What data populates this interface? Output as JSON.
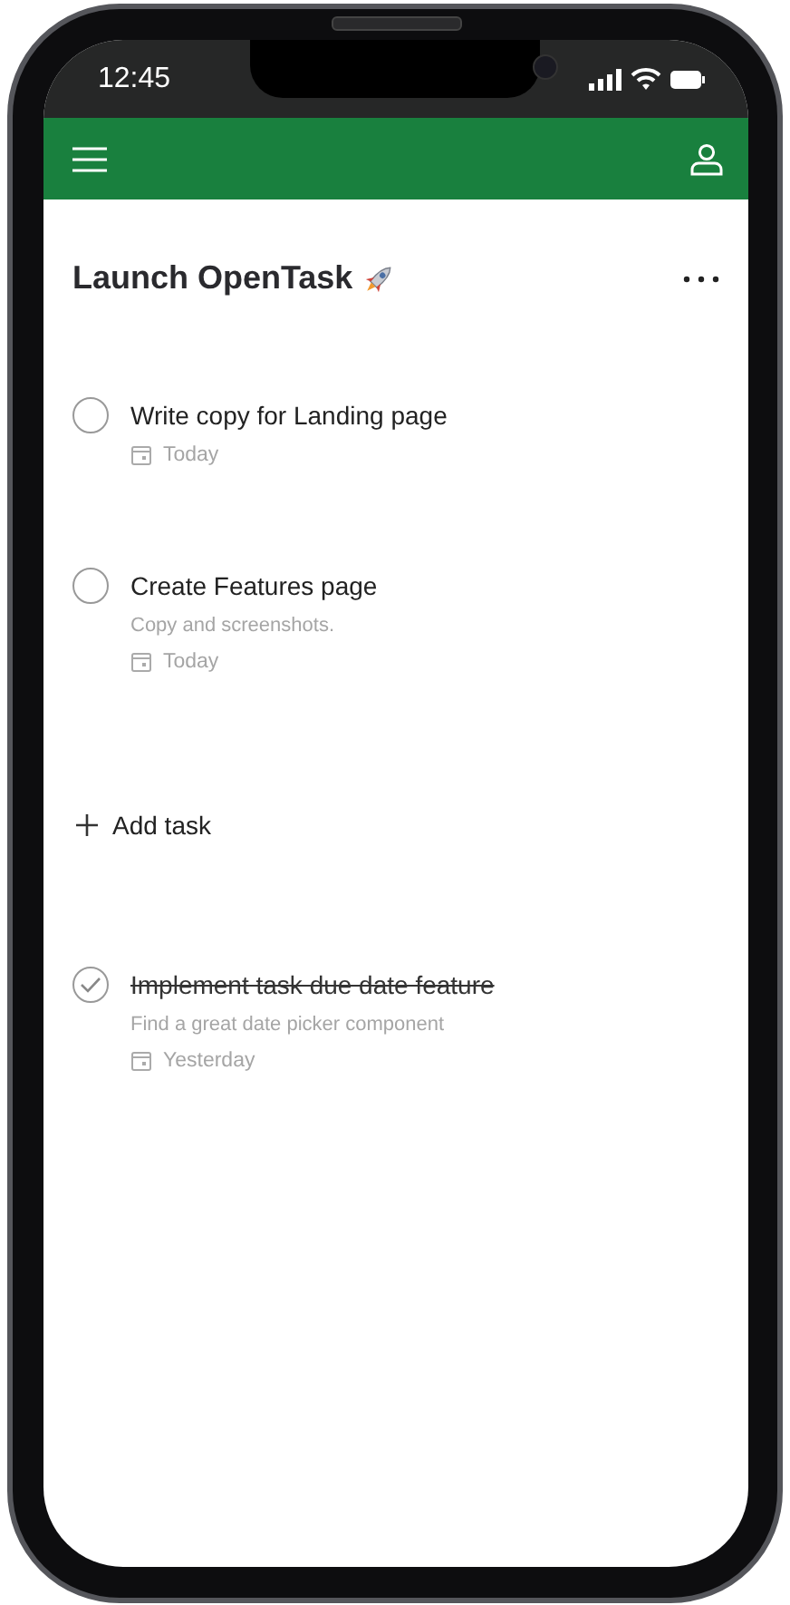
{
  "status_bar": {
    "time": "12:45"
  },
  "project": {
    "title": "Launch OpenTask"
  },
  "open_tasks": [
    {
      "title": "Write copy for Landing page",
      "due": "Today",
      "completed": false
    },
    {
      "title": "Create Features page",
      "description": "Copy and screenshots.",
      "due": "Today",
      "completed": false
    }
  ],
  "add_task": {
    "label": "Add task"
  },
  "completed_tasks": [
    {
      "title": "Implement task due date feature",
      "description": "Find a great date picker component",
      "due": "Yesterday",
      "completed": true
    }
  ]
}
